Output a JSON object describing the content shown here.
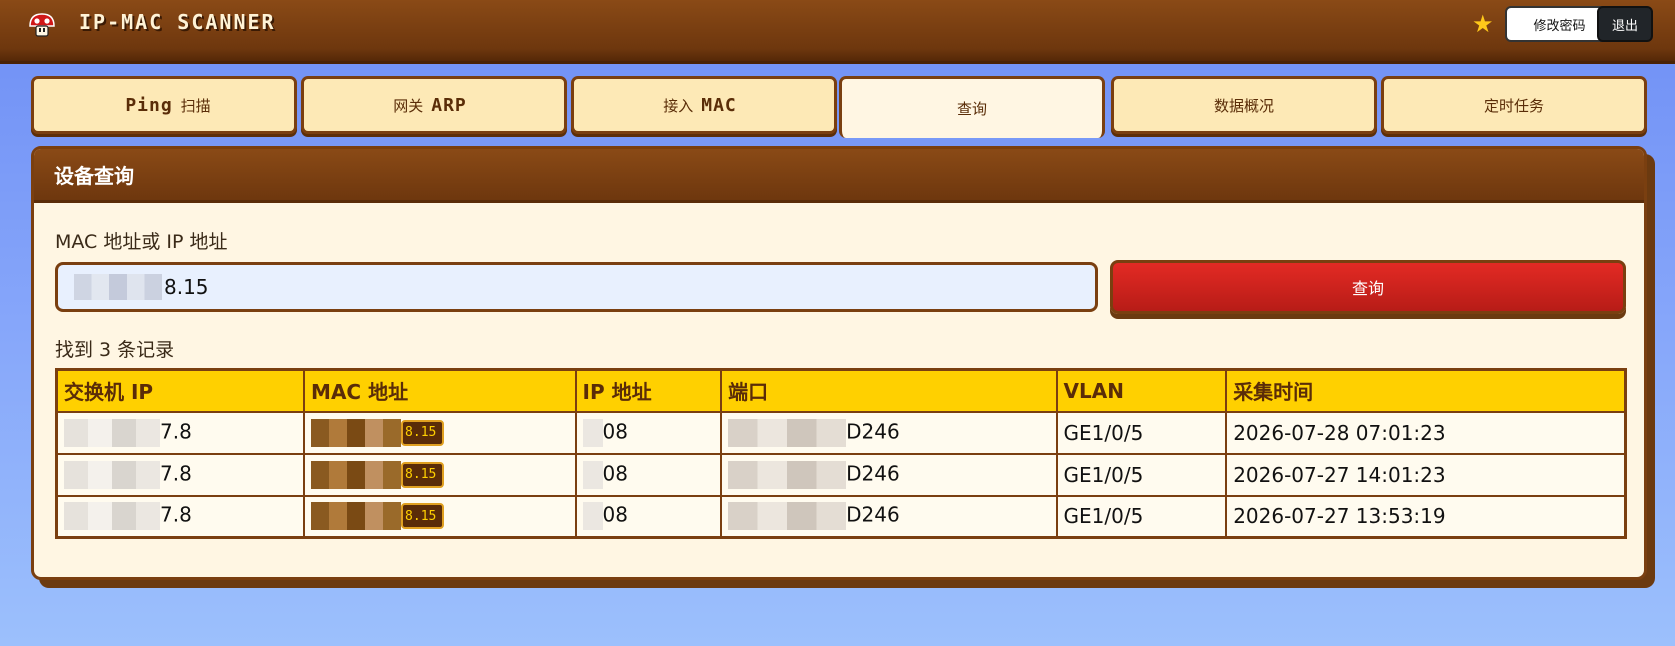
{
  "header": {
    "title": "IP-MAC SCANNER",
    "change_password": "修改密码",
    "logout": "退出"
  },
  "tabs": [
    {
      "pre": "",
      "mono": "Ping",
      "post": "扫描"
    },
    {
      "pre": "网关",
      "mono": "ARP",
      "post": ""
    },
    {
      "pre": "接入",
      "mono": "MAC",
      "post": ""
    },
    {
      "pre": "查询",
      "mono": "",
      "post": "",
      "active": true
    },
    {
      "pre": "数据概况",
      "mono": "",
      "post": ""
    },
    {
      "pre": "定时任务",
      "mono": "",
      "post": ""
    }
  ],
  "card": {
    "title": "设备查询",
    "field_label": "MAC 地址或 IP 地址",
    "input_value": "8.15",
    "search_button": "查询",
    "result_count": "找到 3 条记录"
  },
  "table": {
    "headers": [
      "交换机 IP",
      "MAC 地址",
      "IP 地址",
      "端口",
      "VLAN",
      "采集时间"
    ],
    "rows": [
      {
        "switch_ip": "7.8",
        "mac": "8.15",
        "ip": "08",
        "port": "D246",
        "vlan": "GE1/0/5",
        "time": "2026-07-28 07:01:23"
      },
      {
        "switch_ip": "7.8",
        "mac": "8.15",
        "ip": "08",
        "port": "D246",
        "vlan": "GE1/0/5",
        "time": "2026-07-27 14:01:23"
      },
      {
        "switch_ip": "7.8",
        "mac": "8.15",
        "ip": "08",
        "port": "D246",
        "vlan": "GE1/0/5",
        "time": "2026-07-27 13:53:19"
      }
    ]
  },
  "colors": {
    "header_brown": "#6e370e",
    "accent_yellow": "#ffd000",
    "button_red": "#d82420",
    "background_blue": "#7f9ef7"
  },
  "icons": {
    "logo": "mushroom-icon",
    "favorite": "star-icon"
  }
}
